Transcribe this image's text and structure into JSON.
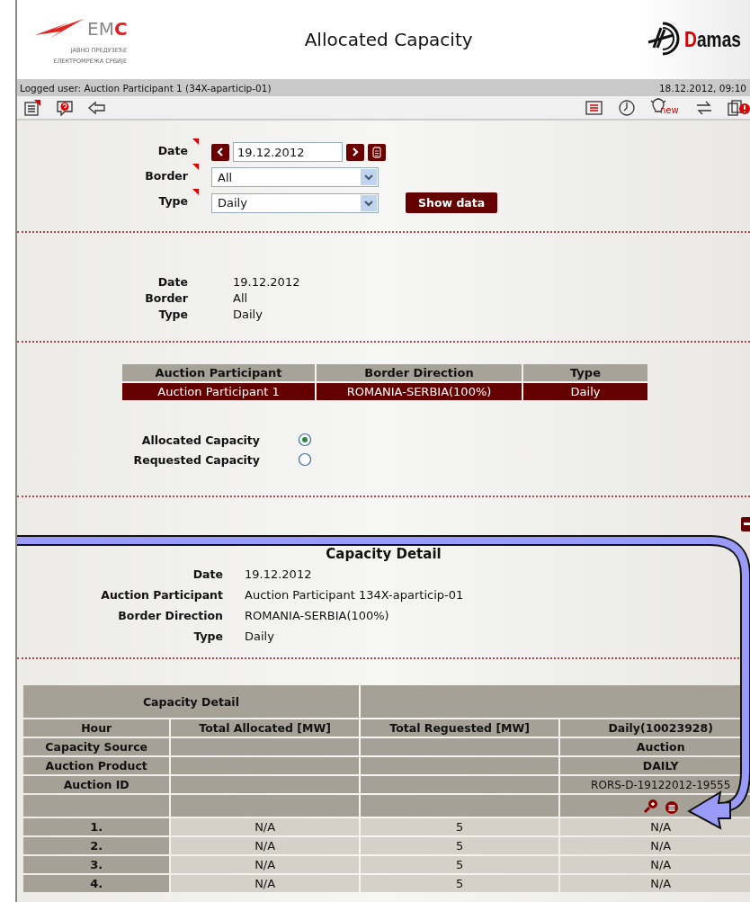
{
  "header": {
    "logo": {
      "name": "EM",
      "accent": "C"
    },
    "logo_subtitle": [
      "ЈАВНО ПРЕДУЗЕЋЕ",
      "ЕЛЕКТРОМРЕЖА СРБИЈЕ"
    ],
    "title": "Allocated Capacity",
    "brand": {
      "accent": "D",
      "name": "amas"
    }
  },
  "status_bar": {
    "logged_user": "Logged user: Auction Participant 1 (34X-aparticip-01)",
    "datetime": "18.12.2012, 09:10"
  },
  "toolbar": {
    "badge": "new"
  },
  "filter_form": {
    "fields": [
      {
        "label": "Date",
        "kind": "date",
        "value": "19.12.2012",
        "required": true
      },
      {
        "label": "Border",
        "kind": "select",
        "value": "All",
        "required": true
      },
      {
        "label": "Type",
        "kind": "select",
        "value": "Daily",
        "required": true
      }
    ],
    "submit": "Show data"
  },
  "summary": [
    {
      "label": "Date",
      "value": "19.12.2012"
    },
    {
      "label": "Border",
      "value": "All"
    },
    {
      "label": "Type",
      "value": "Daily"
    }
  ],
  "participant_table": {
    "columns": [
      "Auction Participant",
      "Border Direction",
      "Type"
    ],
    "rows": [
      [
        "Auction Participant 1",
        "ROMANIA-SERBIA(100%)",
        "Daily"
      ]
    ]
  },
  "capacity_choice": [
    {
      "label": "Allocated Capacity",
      "selected": true
    },
    {
      "label": "Requested Capacity",
      "selected": false
    }
  ],
  "capacity_detail": {
    "title": "Capacity Detail",
    "fields": [
      {
        "label": "Date",
        "value": "19.12.2012"
      },
      {
        "label": "Auction Participant",
        "value": "Auction Participant 134X-aparticip-01"
      },
      {
        "label": "Border Direction",
        "value": "ROMANIA-SERBIA(100%)"
      },
      {
        "label": "Type",
        "value": "Daily"
      }
    ]
  },
  "detail_table": {
    "group_header": "Capacity Detail",
    "columns": [
      "Hour",
      "Total Allocated [MW]",
      "Total Reguested [MW]",
      "Daily(10023928)"
    ],
    "meta_rows": [
      {
        "label": "Capacity Source",
        "value": "Auction",
        "kind": "bold"
      },
      {
        "label": "Auction Product",
        "value": "DAILY",
        "kind": "bold"
      },
      {
        "label": "Auction ID",
        "value": "RORS-D-19122012-19555",
        "kind": "plain"
      }
    ],
    "rows": [
      {
        "hour": "1.",
        "allocated": "N/A",
        "requested": "5",
        "daily": "N/A"
      },
      {
        "hour": "2.",
        "allocated": "N/A",
        "requested": "5",
        "daily": "N/A"
      },
      {
        "hour": "3.",
        "allocated": "N/A",
        "requested": "5",
        "daily": "N/A"
      },
      {
        "hour": "4.",
        "allocated": "N/A",
        "requested": "5",
        "daily": "N/A"
      }
    ]
  }
}
